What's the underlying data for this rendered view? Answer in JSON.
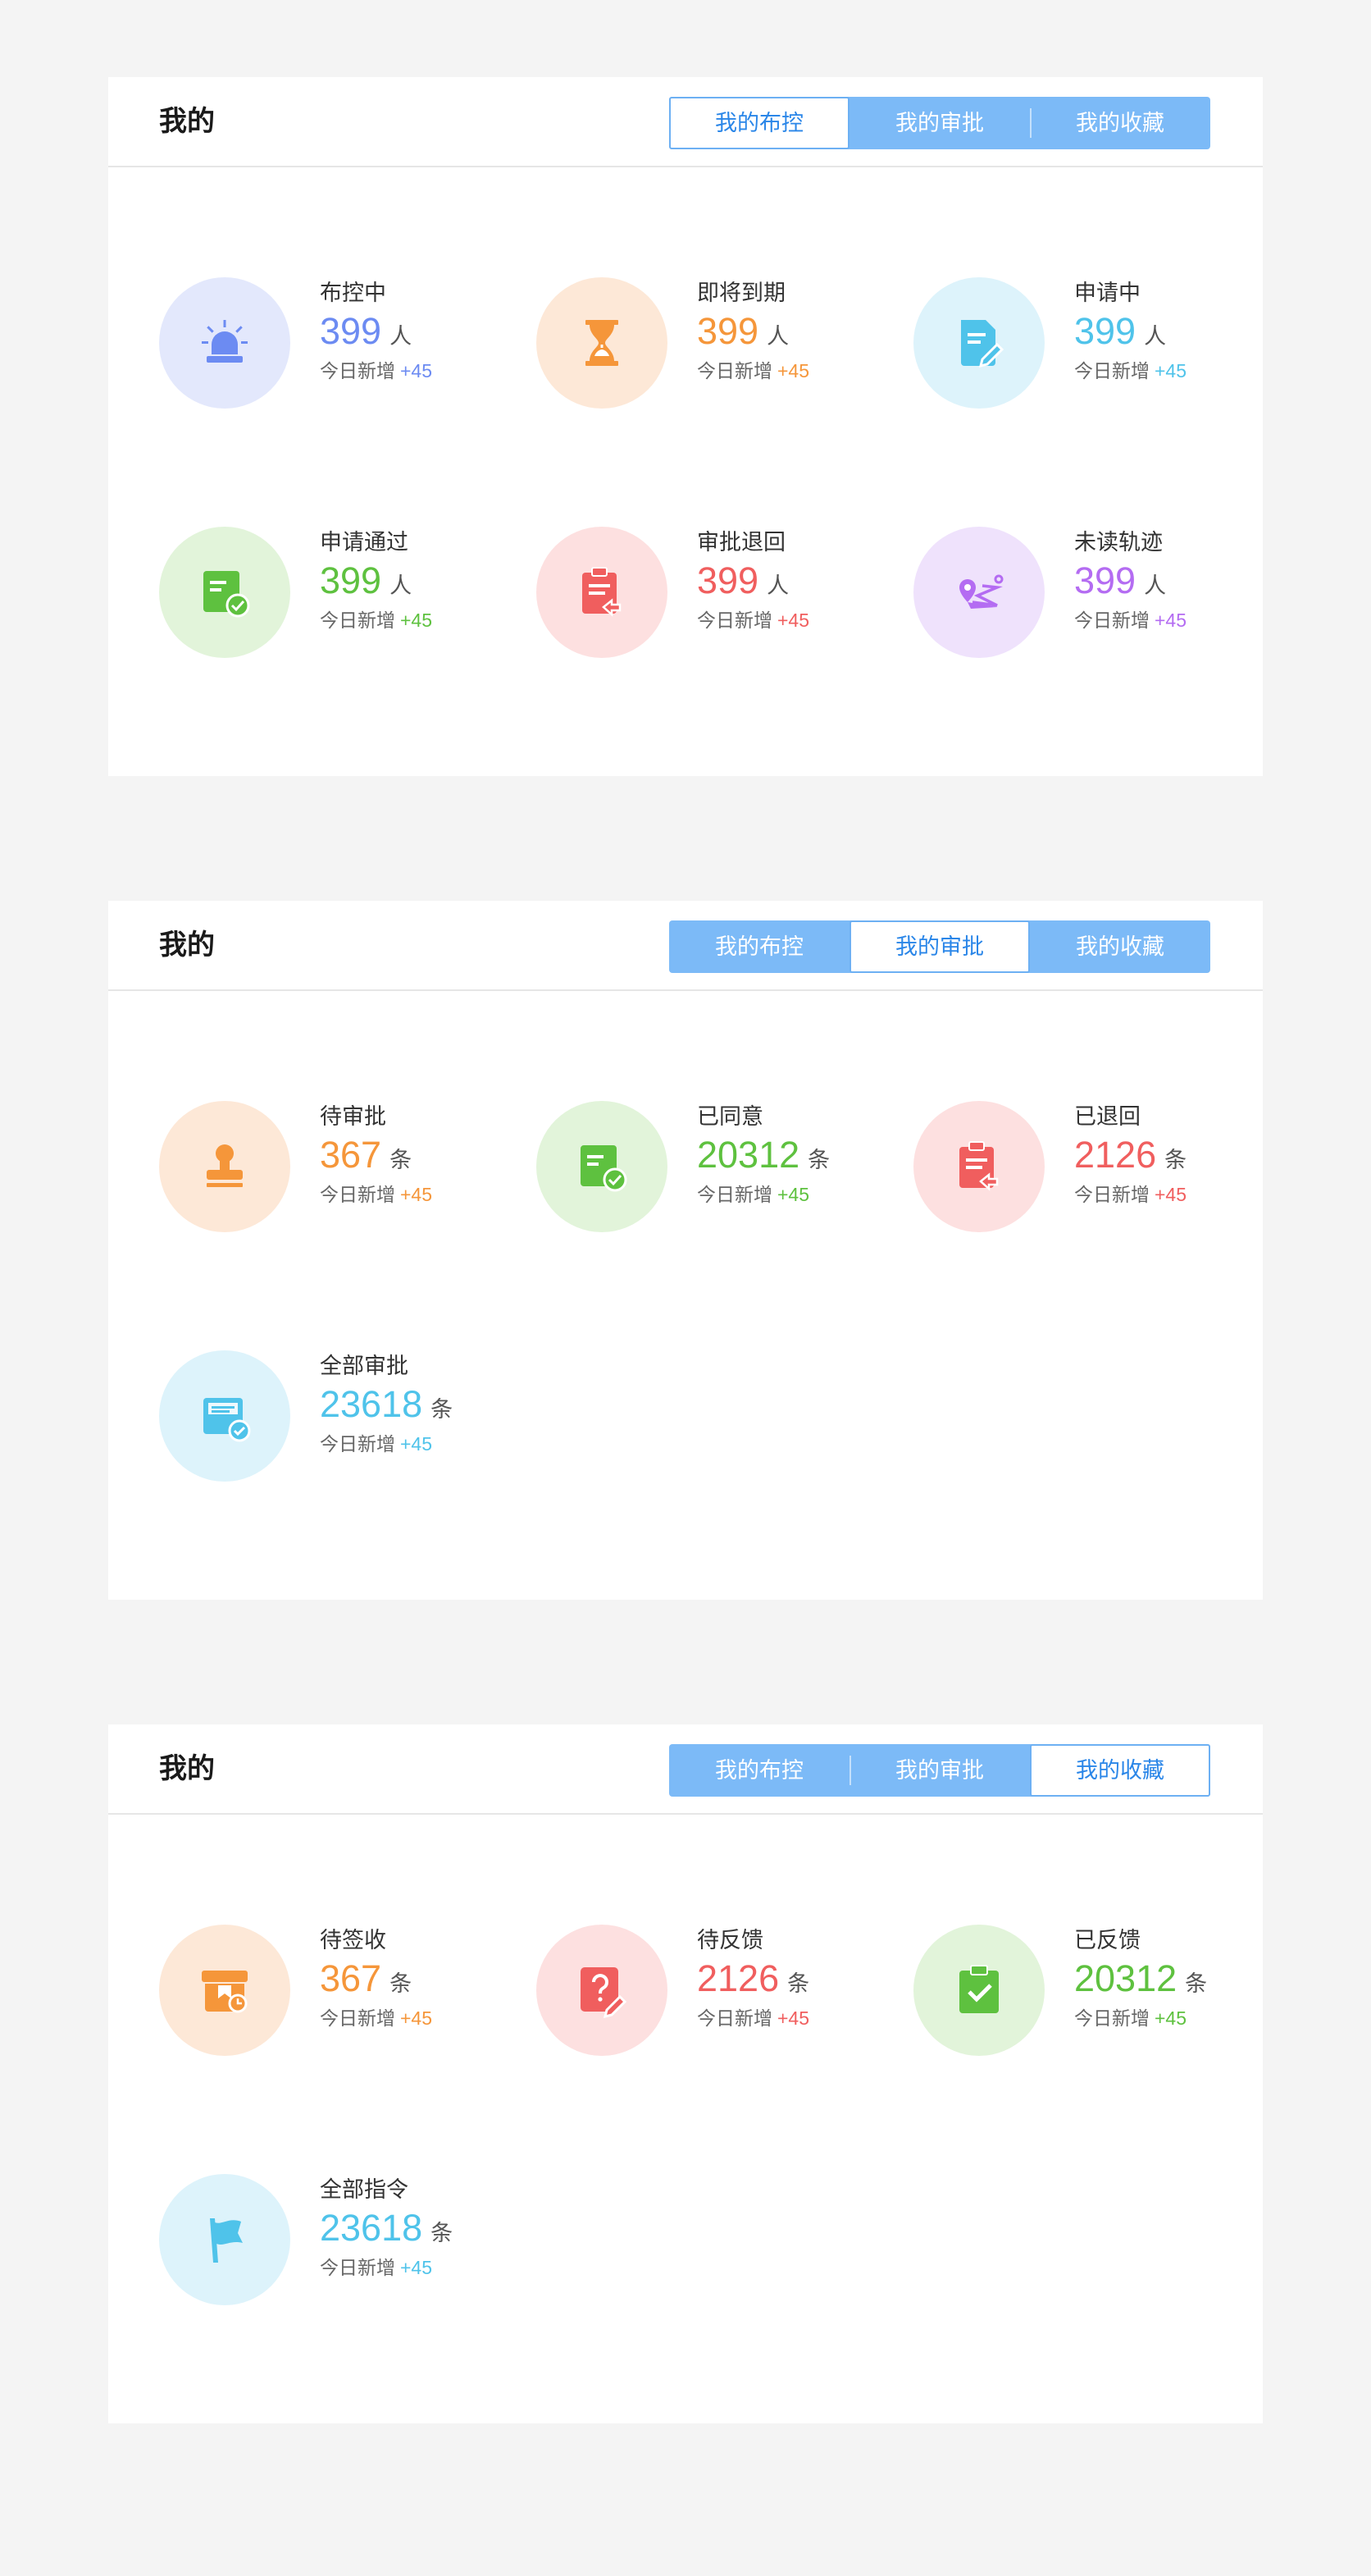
{
  "colors": {
    "blue": "#6c8bf2",
    "blue_bg": "#e3e8fc",
    "orange": "#f5963a",
    "orange_bg": "#fde8d7",
    "cyan": "#4fc3ea",
    "cyan_bg": "#ddf3fb",
    "green": "#5ec13f",
    "green_bg": "#e2f4da",
    "red": "#f05e5e",
    "red_bg": "#fde0e0",
    "purple": "#b46cf2",
    "purple_bg": "#efe2fc",
    "tab_bg": "#7cbaf7",
    "tab_active_text": "#2a86e8"
  },
  "panels": [
    {
      "title": "我的",
      "tabs": [
        "我的布控",
        "我的审批",
        "我的收藏"
      ],
      "active_tab": 0,
      "today_label": "今日新增",
      "stats": [
        {
          "label": "布控中",
          "value": "399",
          "unit": "人",
          "delta": "+45",
          "color": "blue",
          "icon": "alarm-light-icon"
        },
        {
          "label": "即将到期",
          "value": "399",
          "unit": "人",
          "delta": "+45",
          "color": "orange",
          "icon": "hourglass-icon"
        },
        {
          "label": "申请中",
          "value": "399",
          "unit": "人",
          "delta": "+45",
          "color": "cyan",
          "icon": "document-edit-icon"
        },
        {
          "label": "申请通过",
          "value": "399",
          "unit": "人",
          "delta": "+45",
          "color": "green",
          "icon": "document-check-icon"
        },
        {
          "label": "审批退回",
          "value": "399",
          "unit": "人",
          "delta": "+45",
          "color": "red",
          "icon": "clipboard-return-icon"
        },
        {
          "label": "未读轨迹",
          "value": "399",
          "unit": "人",
          "delta": "+45",
          "color": "purple",
          "icon": "map-route-icon"
        }
      ]
    },
    {
      "title": "我的",
      "tabs": [
        "我的布控",
        "我的审批",
        "我的收藏"
      ],
      "active_tab": 1,
      "today_label": "今日新增",
      "stats": [
        {
          "label": "待审批",
          "value": "367",
          "unit": "条",
          "delta": "+45",
          "color": "orange",
          "icon": "stamp-icon"
        },
        {
          "label": "已同意",
          "value": "20312",
          "unit": "条",
          "delta": "+45",
          "color": "green",
          "icon": "document-check-icon"
        },
        {
          "label": "已退回",
          "value": "2126",
          "unit": "条",
          "delta": "+45",
          "color": "red",
          "icon": "clipboard-return-icon"
        },
        {
          "label": "全部审批",
          "value": "23618",
          "unit": "条",
          "delta": "+45",
          "color": "cyan",
          "icon": "folder-check-icon"
        }
      ]
    },
    {
      "title": "我的",
      "tabs": [
        "我的布控",
        "我的审批",
        "我的收藏"
      ],
      "active_tab": 2,
      "today_label": "今日新增",
      "stats": [
        {
          "label": "待签收",
          "value": "367",
          "unit": "条",
          "delta": "+45",
          "color": "orange",
          "icon": "inbox-clock-icon"
        },
        {
          "label": "待反馈",
          "value": "2126",
          "unit": "条",
          "delta": "+45",
          "color": "red",
          "icon": "question-edit-icon"
        },
        {
          "label": "已反馈",
          "value": "20312",
          "unit": "条",
          "delta": "+45",
          "color": "green",
          "icon": "clipboard-check-icon"
        },
        {
          "label": "全部指令",
          "value": "23618",
          "unit": "条",
          "delta": "+45",
          "color": "cyan",
          "icon": "flag-icon"
        }
      ]
    }
  ]
}
